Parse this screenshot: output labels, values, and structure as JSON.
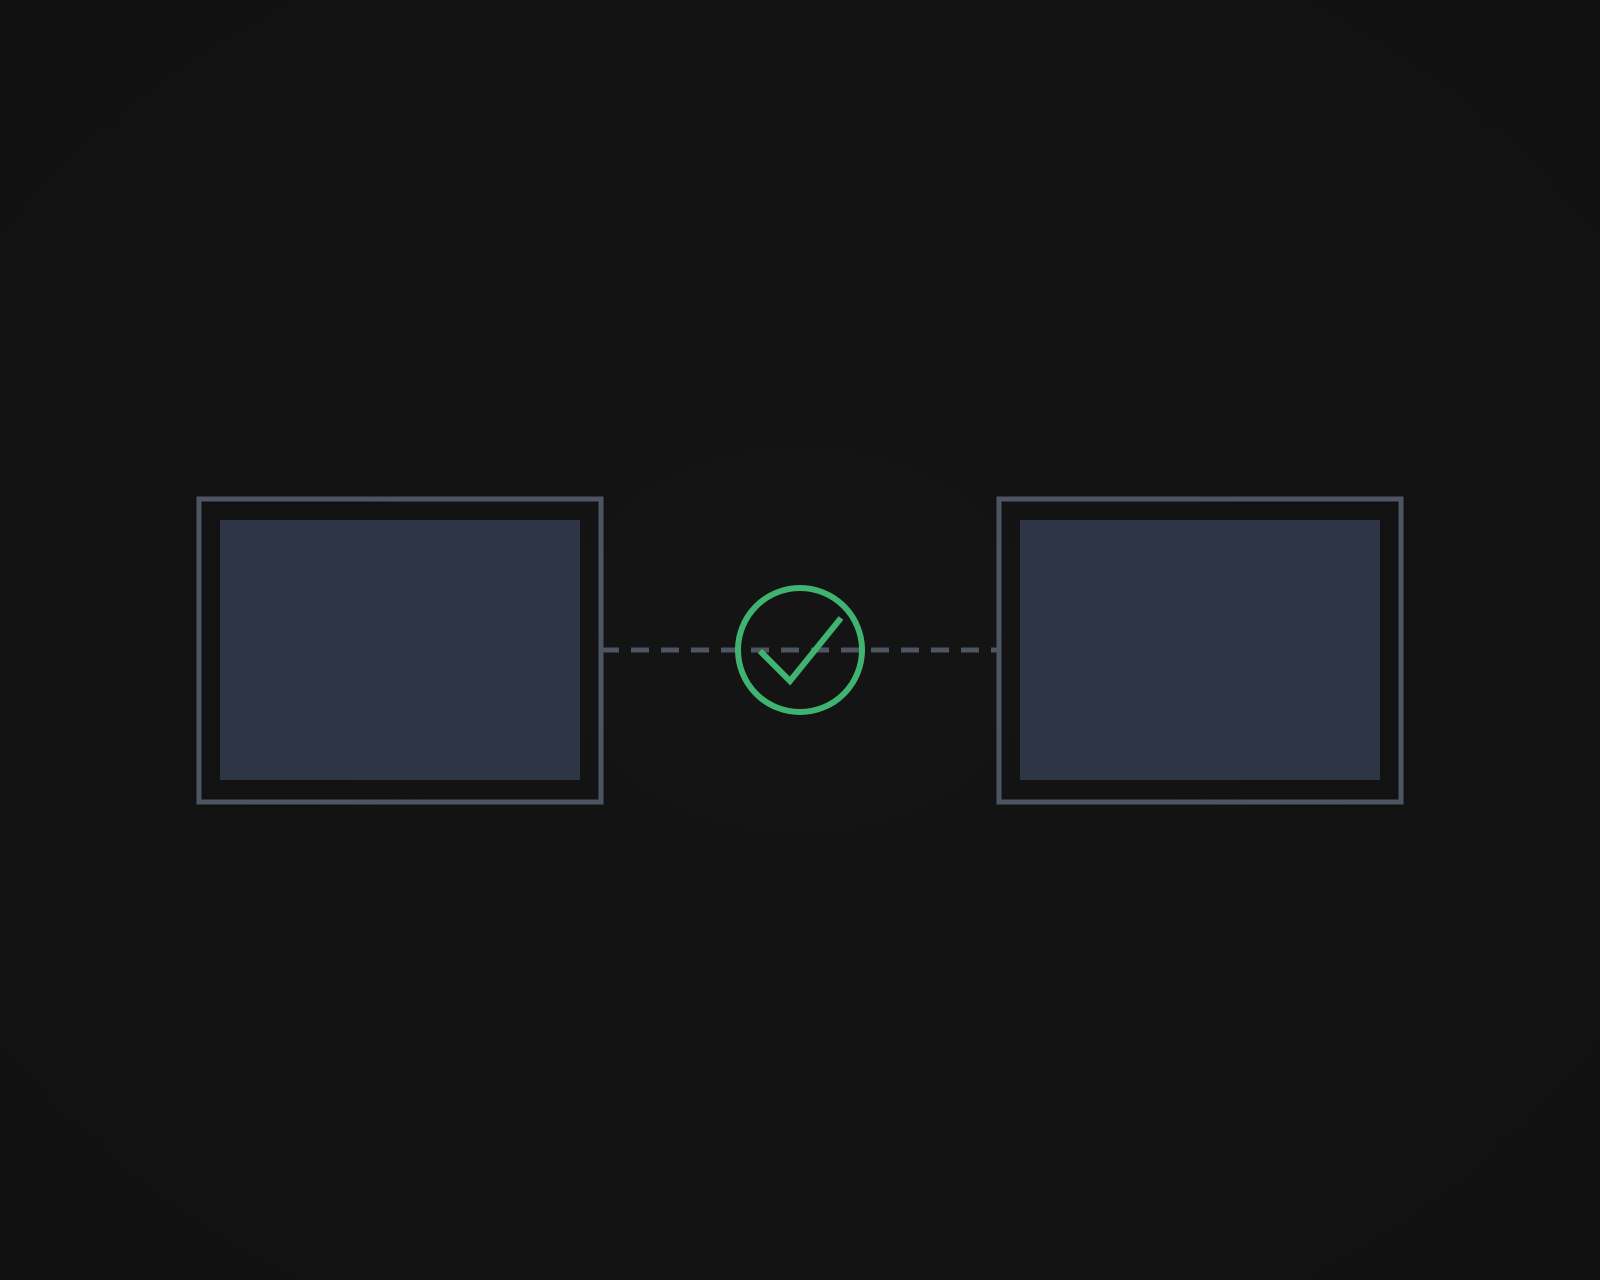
{
  "scene": {
    "colors": {
      "background": "#121212",
      "frame_border": "#4d5563",
      "screen_fill": "#2e3646",
      "connector": "#4d5563",
      "status_ok": "#3fb36f"
    },
    "left_device": {
      "icon": "monitor-icon"
    },
    "right_device": {
      "icon": "monitor-icon"
    },
    "connection": {
      "style": "dashed",
      "status": "connected",
      "status_icon": "check-circle-icon"
    }
  }
}
